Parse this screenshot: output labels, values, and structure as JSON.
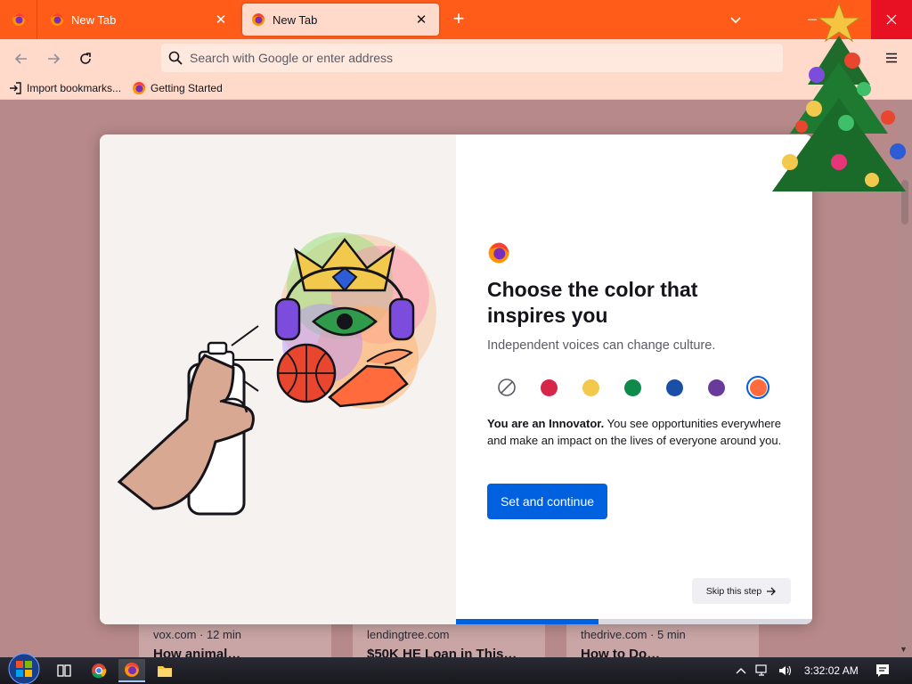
{
  "browser": {
    "tabs": [
      {
        "title": "New Tab",
        "active": false
      },
      {
        "title": "New Tab",
        "active": true
      }
    ],
    "new_tab_symbol": "+",
    "urlbar": {
      "placeholder": "Search with Google or enter address",
      "value": ""
    },
    "bookmarks": [
      {
        "label": "Import bookmarks...",
        "icon": "import-icon"
      },
      {
        "label": "Getting Started",
        "icon": "firefox-icon"
      }
    ]
  },
  "onboarding": {
    "heading": "Choose the color that inspires you",
    "subheading": "Independent voices can change culture.",
    "colorways": [
      {
        "name": "default",
        "color": "#ffffff",
        "selected": false
      },
      {
        "name": "red",
        "color": "#d7264a",
        "selected": false
      },
      {
        "name": "yellow",
        "color": "#f2c94c",
        "selected": false
      },
      {
        "name": "green",
        "color": "#0e8a4a",
        "selected": false
      },
      {
        "name": "blue",
        "color": "#1a4fa8",
        "selected": false
      },
      {
        "name": "purple",
        "color": "#6a3a9a",
        "selected": false
      },
      {
        "name": "orange",
        "color": "#ff6b3d",
        "selected": true
      }
    ],
    "description_bold": "You are an Innovator.",
    "description_text": " You see opportunities everywhere and make an impact on the lives of everyone around you.",
    "primary_button": "Set and continue",
    "skip_button": "Skip this step",
    "progress": 0.4
  },
  "newtab_cards": [
    {
      "source": "vox.com · 12 min",
      "headline": "How animal…"
    },
    {
      "source": "lendingtree.com",
      "headline": "$50K HE Loan in This…"
    },
    {
      "source": "thedrive.com · 5 min",
      "headline": "How to Do…"
    }
  ],
  "taskbar": {
    "time": "3:32:02 AM"
  },
  "colors": {
    "tabstrip": "#ff5c1a",
    "toolbar": "#ffd9c9",
    "accent": "#0061e0",
    "content_bg": "#b7898a"
  }
}
